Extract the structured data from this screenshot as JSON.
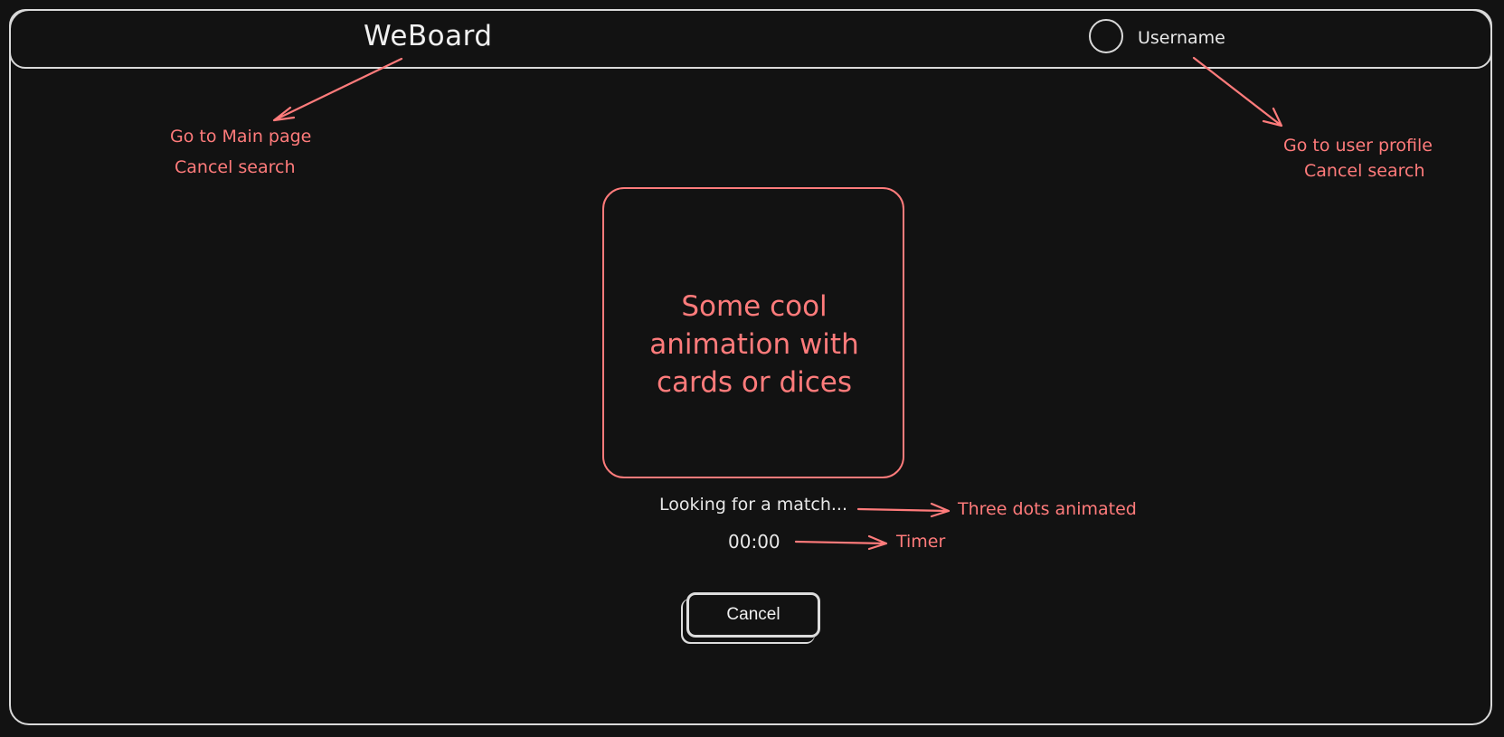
{
  "header": {
    "logo": "WeBoard",
    "username": "Username"
  },
  "annotations": {
    "logo_note_1": "Go to Main page",
    "logo_note_2": "Cancel search",
    "profile_note_1": "Go to user profile",
    "profile_note_2": "Cancel search",
    "status_note": "Three dots animated",
    "timer_note": "Timer"
  },
  "main": {
    "animation_placeholder": "Some cool animation with cards or dices",
    "status_text": "Looking for a match...",
    "timer": "00:00",
    "cancel_label": "Cancel"
  },
  "colors": {
    "background": "#121212",
    "sketch_line": "#d9d9d9",
    "annotation": "#ff7b7b"
  }
}
